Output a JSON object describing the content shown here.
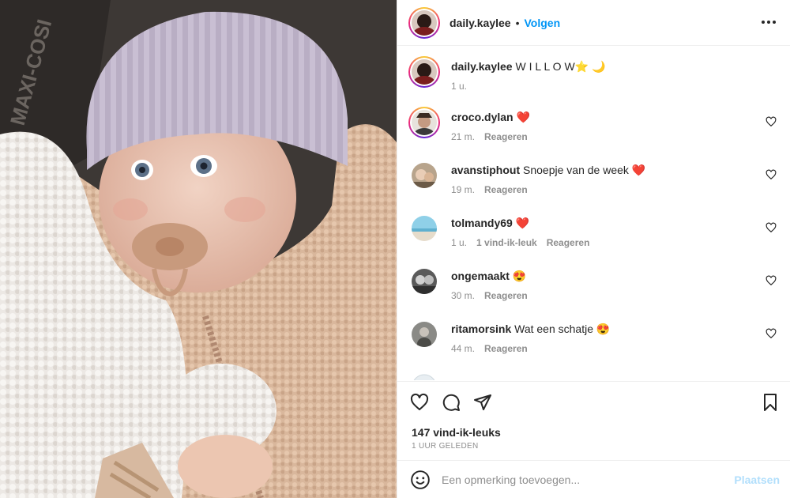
{
  "photo": {
    "alt_brand": "MAXI-COSI"
  },
  "header": {
    "username": "daily.kaylee",
    "separator": "•",
    "follow_label": "Volgen",
    "more_icon": "more-horizontal-icon"
  },
  "caption": {
    "username": "daily.kaylee",
    "text": "W I L L O W⭐️ 🌙",
    "time": "1 u."
  },
  "comments": [
    {
      "username": "croco.dylan",
      "text": "❤️",
      "time": "21 m.",
      "likes": "",
      "reply": "Reageren"
    },
    {
      "username": "avanstiphout",
      "text": "Snoepje van de week ❤️",
      "time": "19 m.",
      "likes": "",
      "reply": "Reageren"
    },
    {
      "username": "tolmandy69",
      "text": "❤️",
      "time": "1 u.",
      "likes": "1 vind-ik-leuk",
      "reply": "Reageren"
    },
    {
      "username": "ongemaakt",
      "text": "😍",
      "time": "30 m.",
      "likes": "",
      "reply": "Reageren"
    },
    {
      "username": "ritamorsink",
      "text": "Wat een schatje 😍",
      "time": "44 m.",
      "likes": "",
      "reply": "Reageren"
    }
  ],
  "actions": {
    "like_icon": "heart-icon",
    "comment_icon": "comment-icon",
    "share_icon": "send-icon",
    "save_icon": "bookmark-icon",
    "likes": "147 vind-ik-leuks",
    "time": "1 UUR GELEDEN"
  },
  "add_comment": {
    "placeholder": "Een opmerking toevoegen...",
    "post_label": "Plaatsen"
  },
  "colors": {
    "accent": "#0095f6",
    "post_disabled": "#b2dffc",
    "heart_red": "#ed4956"
  }
}
